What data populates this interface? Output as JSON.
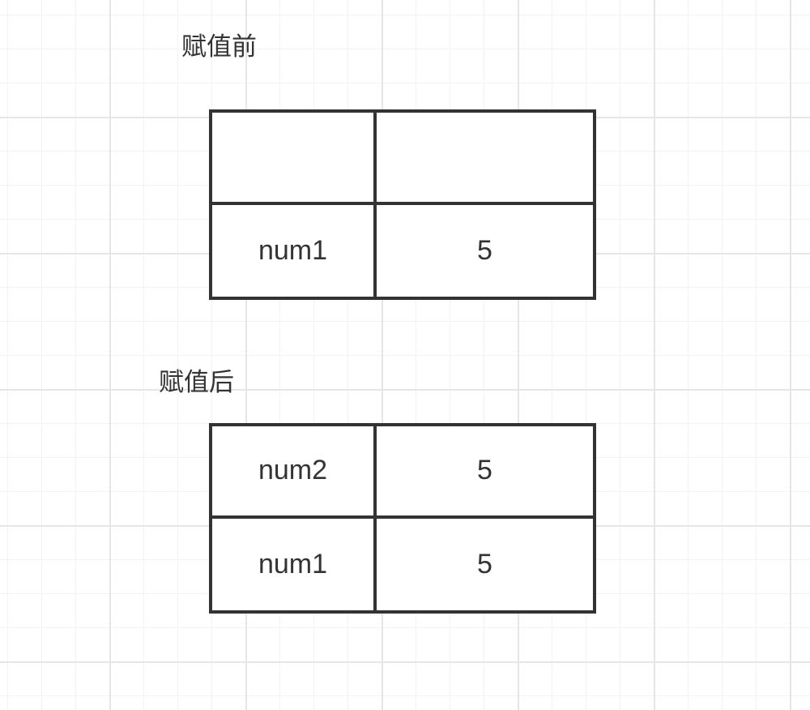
{
  "before": {
    "heading": "赋值前",
    "rows": [
      {
        "name": "",
        "value": ""
      },
      {
        "name": "num1",
        "value": "5"
      }
    ]
  },
  "after": {
    "heading": "赋值后",
    "rows": [
      {
        "name": "num2",
        "value": "5"
      },
      {
        "name": "num1",
        "value": "5"
      }
    ]
  }
}
